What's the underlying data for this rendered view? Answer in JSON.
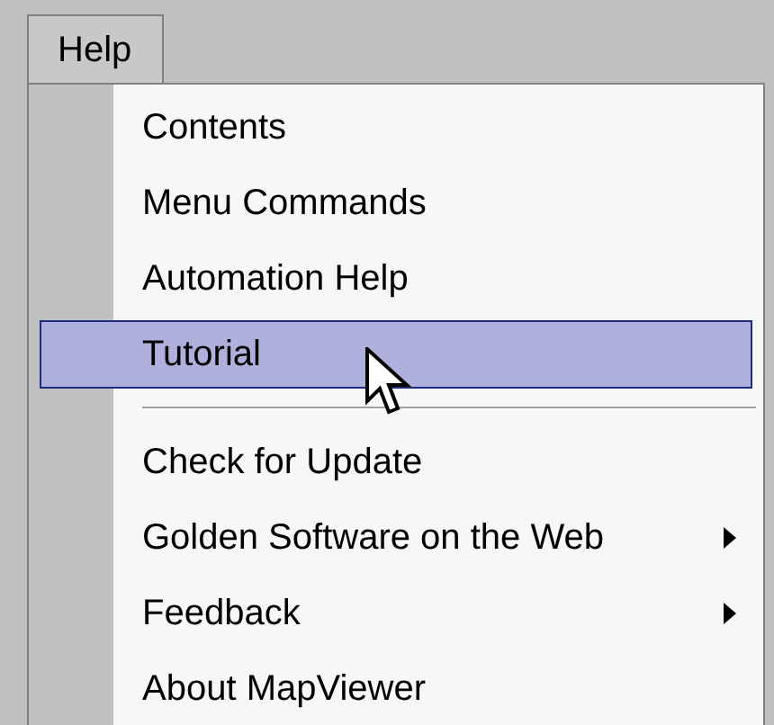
{
  "menu_bar": {
    "title": "Help"
  },
  "menu": {
    "items": [
      {
        "kind": "item",
        "label": "Contents",
        "selected": false,
        "submenu": false
      },
      {
        "kind": "item",
        "label": "Menu Commands",
        "selected": false,
        "submenu": false
      },
      {
        "kind": "item",
        "label": "Automation Help",
        "selected": false,
        "submenu": false
      },
      {
        "kind": "item",
        "label": "Tutorial",
        "selected": true,
        "submenu": false
      },
      {
        "kind": "separator"
      },
      {
        "kind": "item",
        "label": "Check for Update",
        "selected": false,
        "submenu": false
      },
      {
        "kind": "item",
        "label": "Golden Software on the Web",
        "selected": false,
        "submenu": true
      },
      {
        "kind": "item",
        "label": "Feedback",
        "selected": false,
        "submenu": true
      },
      {
        "kind": "item",
        "label": "About MapViewer",
        "selected": false,
        "submenu": false
      }
    ]
  }
}
